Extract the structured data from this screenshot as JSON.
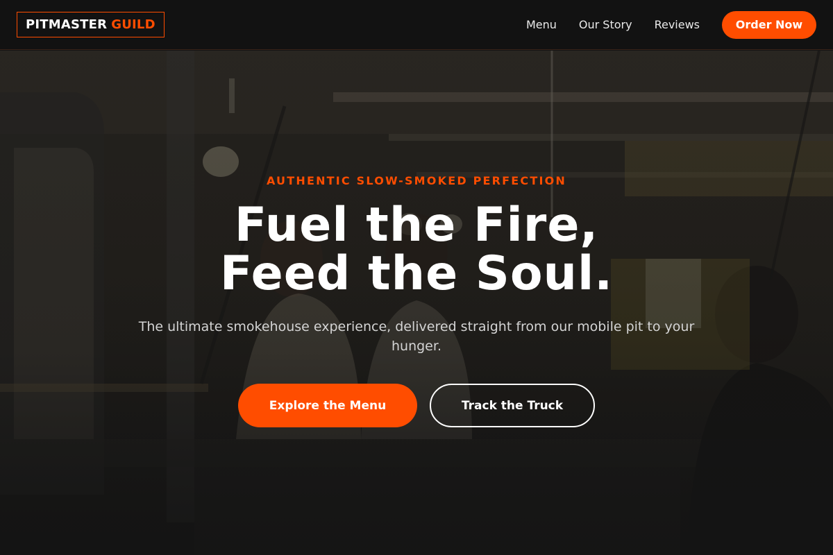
{
  "nav": {
    "logo_main": "PITMASTER",
    "logo_accent": "GUILD",
    "links": [
      "Menu",
      "Our Story",
      "Reviews"
    ],
    "cta_label": "Order Now"
  },
  "hero": {
    "eyebrow": "AUTHENTIC SLOW-SMOKED PERFECTION",
    "headline_line1": "Fuel the Fire,",
    "headline_line2": "Feed the Soul.",
    "subtext": "The ultimate smokehouse experience, delivered straight from our mobile pit to your hunger.",
    "primary_cta": "Explore the Menu",
    "secondary_cta": "Track the Truck",
    "background_image": "food-truck-interior-photo"
  },
  "colors": {
    "accent": "#ff4d00",
    "background": "#121212",
    "text": "#ffffff",
    "muted_text": "#d4d4d4"
  }
}
